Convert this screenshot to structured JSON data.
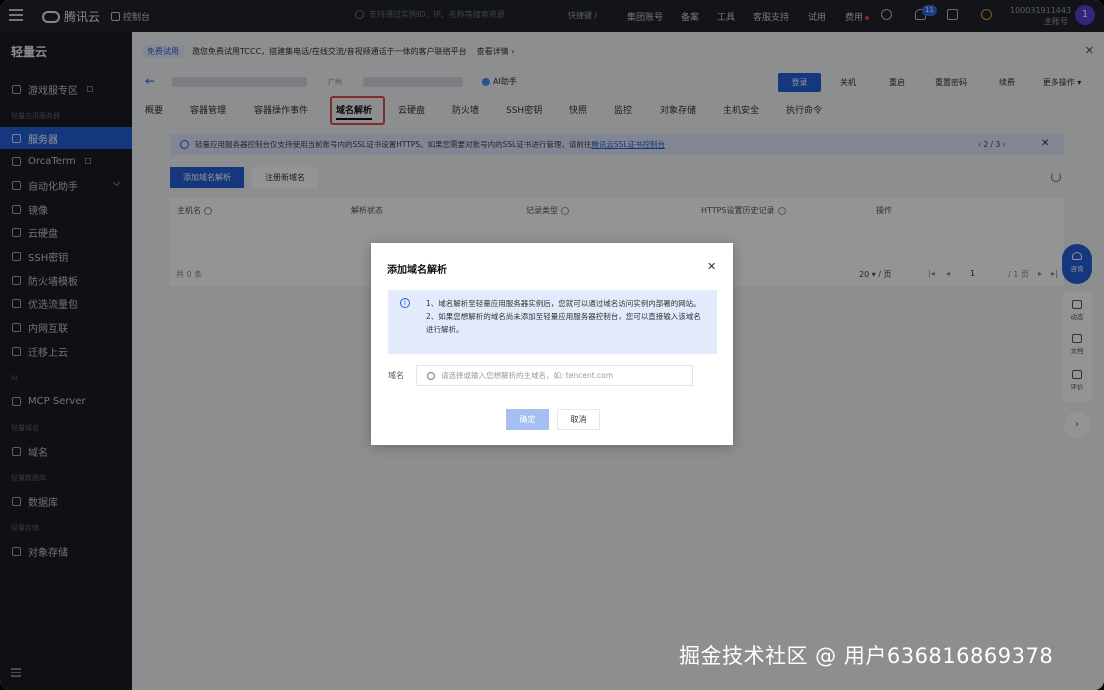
{
  "topbar": {
    "logo": "腾讯云",
    "console": "控制台",
    "search_placeholder": "支持通过实例ID、IP、名称等搜索资源",
    "shortcut": "快捷键 /",
    "links": [
      "集团账号",
      "备案",
      "工具",
      "客服支持",
      "试用",
      "费用"
    ],
    "notification_count": "11",
    "account_id": "100031911443",
    "account_role": "主账号",
    "avatar_letter": "1"
  },
  "sidebar": {
    "title": "轻量云",
    "groups": {
      "g1": "轻量应用服务器",
      "g2": "AI",
      "g3": "轻量域名",
      "g4": "轻量数据库",
      "g5": "轻量存储"
    },
    "items": [
      "游戏服专区",
      "服务器",
      "OrcaTerm",
      "自动化助手",
      "镜像",
      "云硬盘",
      "SSH密钥",
      "防火墙模板",
      "优选流量包",
      "内网互联",
      "迁移上云",
      "MCP Server",
      "域名",
      "数据库",
      "对象存储"
    ]
  },
  "banner": {
    "tag": "免费试用",
    "text": "邀您免费试用TCCC，搭建集电话/在线交流/音视频通话于一体的客户联络平台",
    "more": "查看详情 ›"
  },
  "header": {
    "region": "广州",
    "ai_label": "AI助手",
    "buttons": [
      "登录",
      "关机",
      "重启",
      "重置密码",
      "续费",
      "更多操作 ▾"
    ]
  },
  "tabs": [
    "概要",
    "容器管理",
    "容器操作事件",
    "域名解析",
    "云硬盘",
    "防火墙",
    "SSH密钥",
    "快照",
    "监控",
    "对象存储",
    "主机安全",
    "执行命令"
  ],
  "infobar": {
    "text": "轻量应用服务器控制台仅支持使用当前账号内的SSL证书设置HTTPS。如果您需要对账号内的SSL证书进行管理，请前往",
    "link": "腾讯云SSL证书控制台",
    "pager": "‹  2 / 3  ›"
  },
  "actions": {
    "add": "添加域名解析",
    "register": "注册新域名"
  },
  "table": {
    "columns": [
      "主机名",
      "解析状态",
      "记录类型",
      "HTTPS设置历史记录",
      "操作"
    ],
    "total": "共 0 条",
    "page_size": "20 ▾ / 页",
    "page_num": "1",
    "page_total": "/ 1 页"
  },
  "rail": {
    "chat": "咨询",
    "items": [
      "动态",
      "文档",
      "评价"
    ]
  },
  "modal": {
    "title": "添加域名解析",
    "note_1": "1、域名解析至轻量应用服务器实例后，您就可以通过域名访问实例内部署的网站。",
    "note_2": "2、如果您想解析的域名尚未添加至轻量应用服务器控制台，您可以直接输入该域名进行解析。",
    "label": "域名",
    "placeholder": "请选择或输入您想解析的主域名，如: tencent.com",
    "ok": "确定",
    "cancel": "取消"
  },
  "watermark": "掘金技术社区 @ 用户636816869378"
}
